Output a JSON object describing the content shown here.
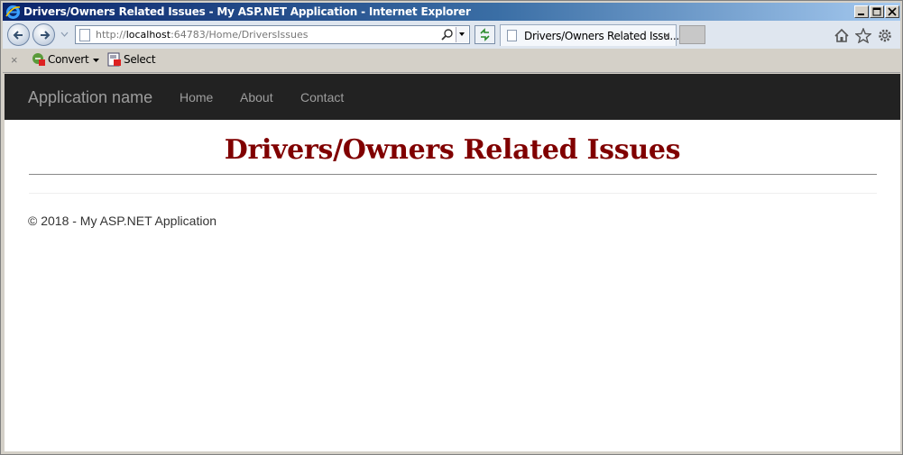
{
  "window": {
    "title": "Drivers/Owners Related Issues - My ASP.NET Application - Internet Explorer"
  },
  "browser": {
    "url_prefix": "http://",
    "url_host": "localhost",
    "url_rest": ":64783/Home/DriversIssues",
    "tab_label": "Drivers/Owners Related Issu...",
    "tab_close": "×"
  },
  "commandbar": {
    "close_glyph": "×",
    "convert_label": "Convert",
    "select_label": "Select"
  },
  "app": {
    "brand": "Application name",
    "nav": [
      "Home",
      "About",
      "Contact"
    ]
  },
  "page": {
    "heading": "Drivers/Owners Related Issues",
    "footer": "© 2018 - My ASP.NET Application"
  },
  "colors": {
    "heading": "#800000",
    "navbar": "#222222",
    "titlebar": "#0a246a"
  }
}
